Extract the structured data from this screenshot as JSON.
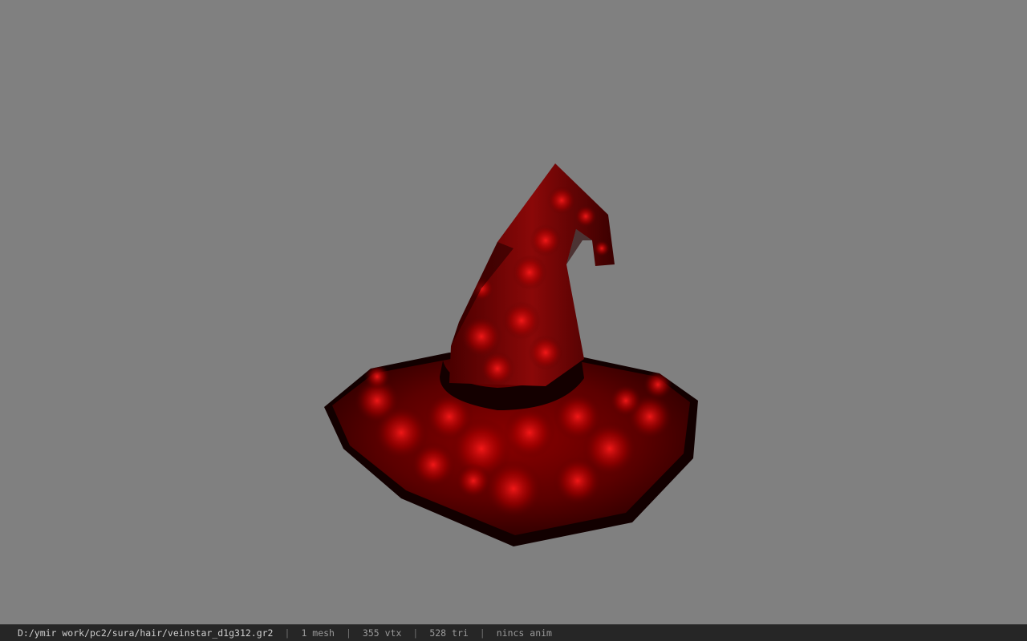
{
  "status_bar": {
    "file_path": "D:/ymir work/pc2/sura/hair/veinstar_d1g312.gr2",
    "separator": "|",
    "mesh_count": "1 mesh",
    "vertex_count": "355 vtx",
    "triangle_count": "528 tri",
    "anim_status": "nincs anim"
  },
  "colors": {
    "viewport_background": "#808080",
    "status_bar_background": "#262626",
    "hat_base": "#5a0000",
    "hat_glow": "#e00000"
  },
  "model": {
    "icon_name": "witch-hat-model"
  }
}
